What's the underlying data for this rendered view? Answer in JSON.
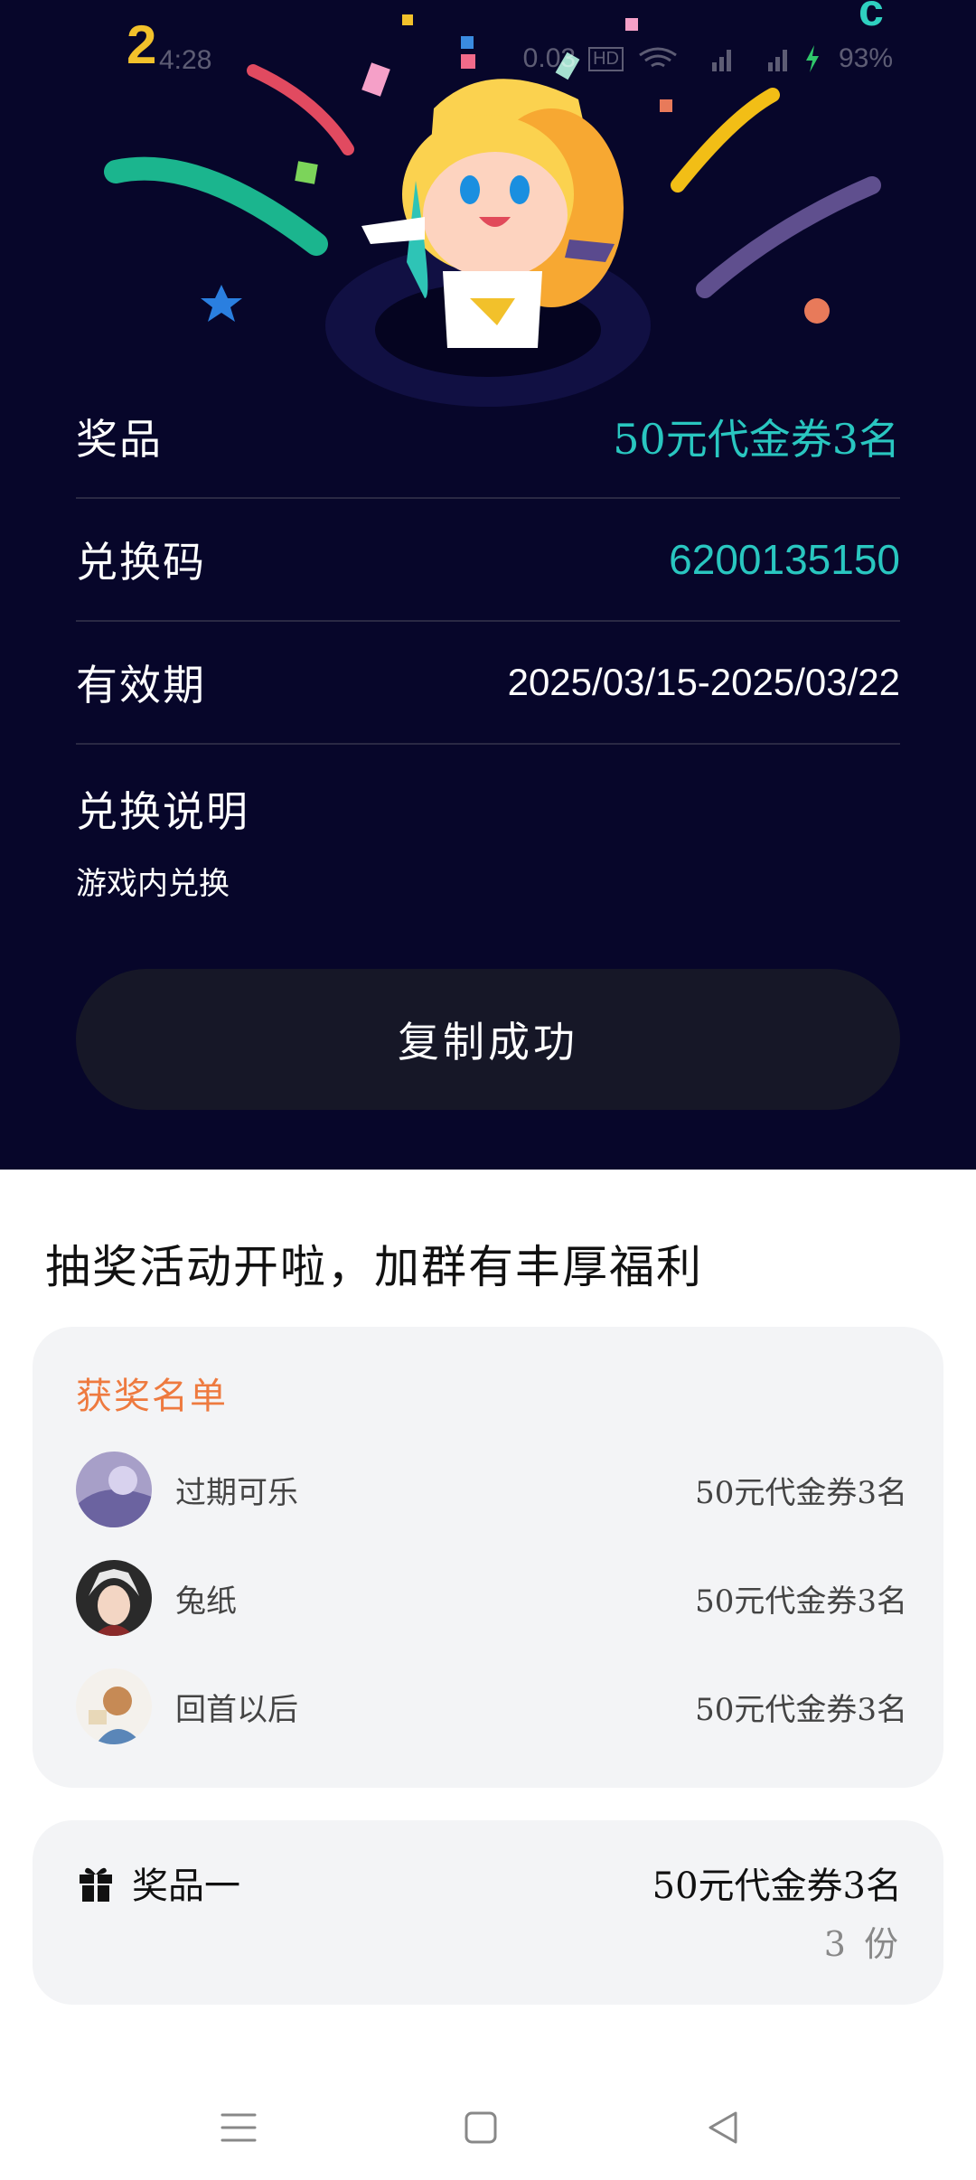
{
  "status_bar": {
    "time": "4:28",
    "network_speed": "0.03",
    "network_tag": "HD",
    "battery_percent": "93%"
  },
  "details": {
    "prize_label": "奖品",
    "prize_value": "50元代金券3名",
    "code_label": "兑换码",
    "code_value": "6200135150",
    "validity_label": "有效期",
    "validity_value": "2025/03/15-2025/03/22",
    "instructions_title": "兑换说明",
    "instructions_text": "游戏内兑换",
    "copy_button": "复制成功"
  },
  "promo_text": "抽奖活动开啦，加群有丰厚福利",
  "winners": {
    "title": "获奖名单",
    "list": [
      {
        "name": "过期可乐",
        "prize": "50元代金券3名"
      },
      {
        "name": "兔纸",
        "prize": "50元代金券3名"
      },
      {
        "name": "回首以后",
        "prize": "50元代金券3名"
      }
    ]
  },
  "prize_card": {
    "icon": "gift-icon",
    "label": "奖品一",
    "value": "50元代金券3名",
    "count": "3 份"
  },
  "nav": {
    "icons": [
      "menu-icon",
      "home-icon",
      "back-icon"
    ]
  }
}
